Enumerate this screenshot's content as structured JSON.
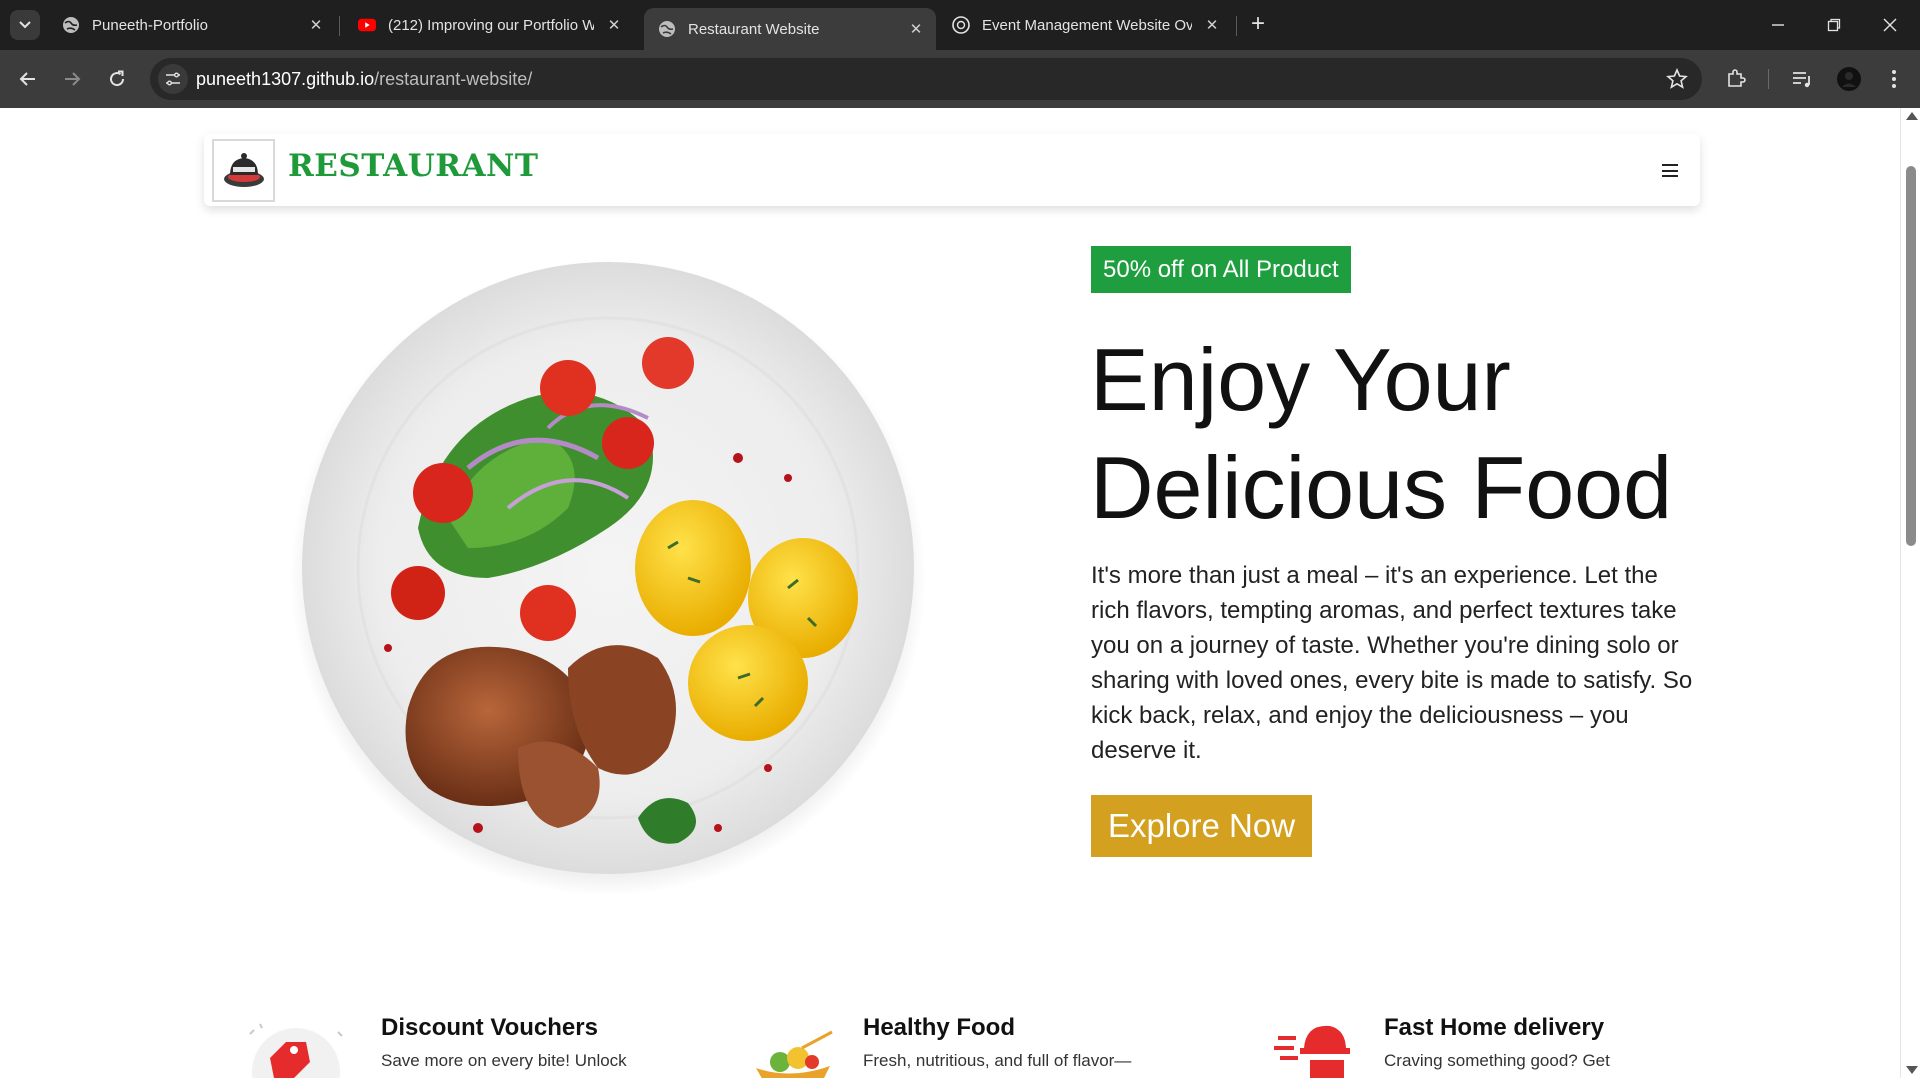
{
  "browser": {
    "tabs": [
      {
        "title": "Puneeth-Portfolio",
        "favicon": "globe-icon",
        "active": false
      },
      {
        "title": "(212) Improving our Portfolio W",
        "favicon": "youtube-icon",
        "active": false
      },
      {
        "title": "Restaurant Website",
        "favicon": "globe-icon",
        "active": true
      },
      {
        "title": "Event Management Website Ov",
        "favicon": "chatgpt-icon",
        "active": false
      }
    ],
    "url_host": "puneeth1307.github.io",
    "url_path": "/restaurant-website/"
  },
  "site": {
    "brand": "RESTAURANT",
    "brand_color": "#1f9a3a",
    "promo_badge": "50% off on All Product",
    "promo_color": "#1e9e3e",
    "hero_title_line1": "Enjoy Your",
    "hero_title_line2": "Delicious Food",
    "hero_text": "It's more than just a meal – it's an experience. Let the rich flavors, tempting aromas, and perfect textures take you on a journey of taste. Whether you're dining solo or sharing with loved ones, every bite is made to satisfy. So kick back, relax, and enjoy the deliciousness – you deserve it.",
    "cta_label": "Explore Now",
    "cta_color": "#d4a01f",
    "features": [
      {
        "title": "Discount Vouchers",
        "desc": "Save more on every bite! Unlock",
        "icon": "voucher-icon"
      },
      {
        "title": "Healthy Food",
        "desc": "Fresh, nutritious, and full of flavor—",
        "icon": "salad-icon"
      },
      {
        "title": "Fast Home delivery",
        "desc": "Craving something good? Get",
        "icon": "delivery-icon"
      }
    ]
  }
}
